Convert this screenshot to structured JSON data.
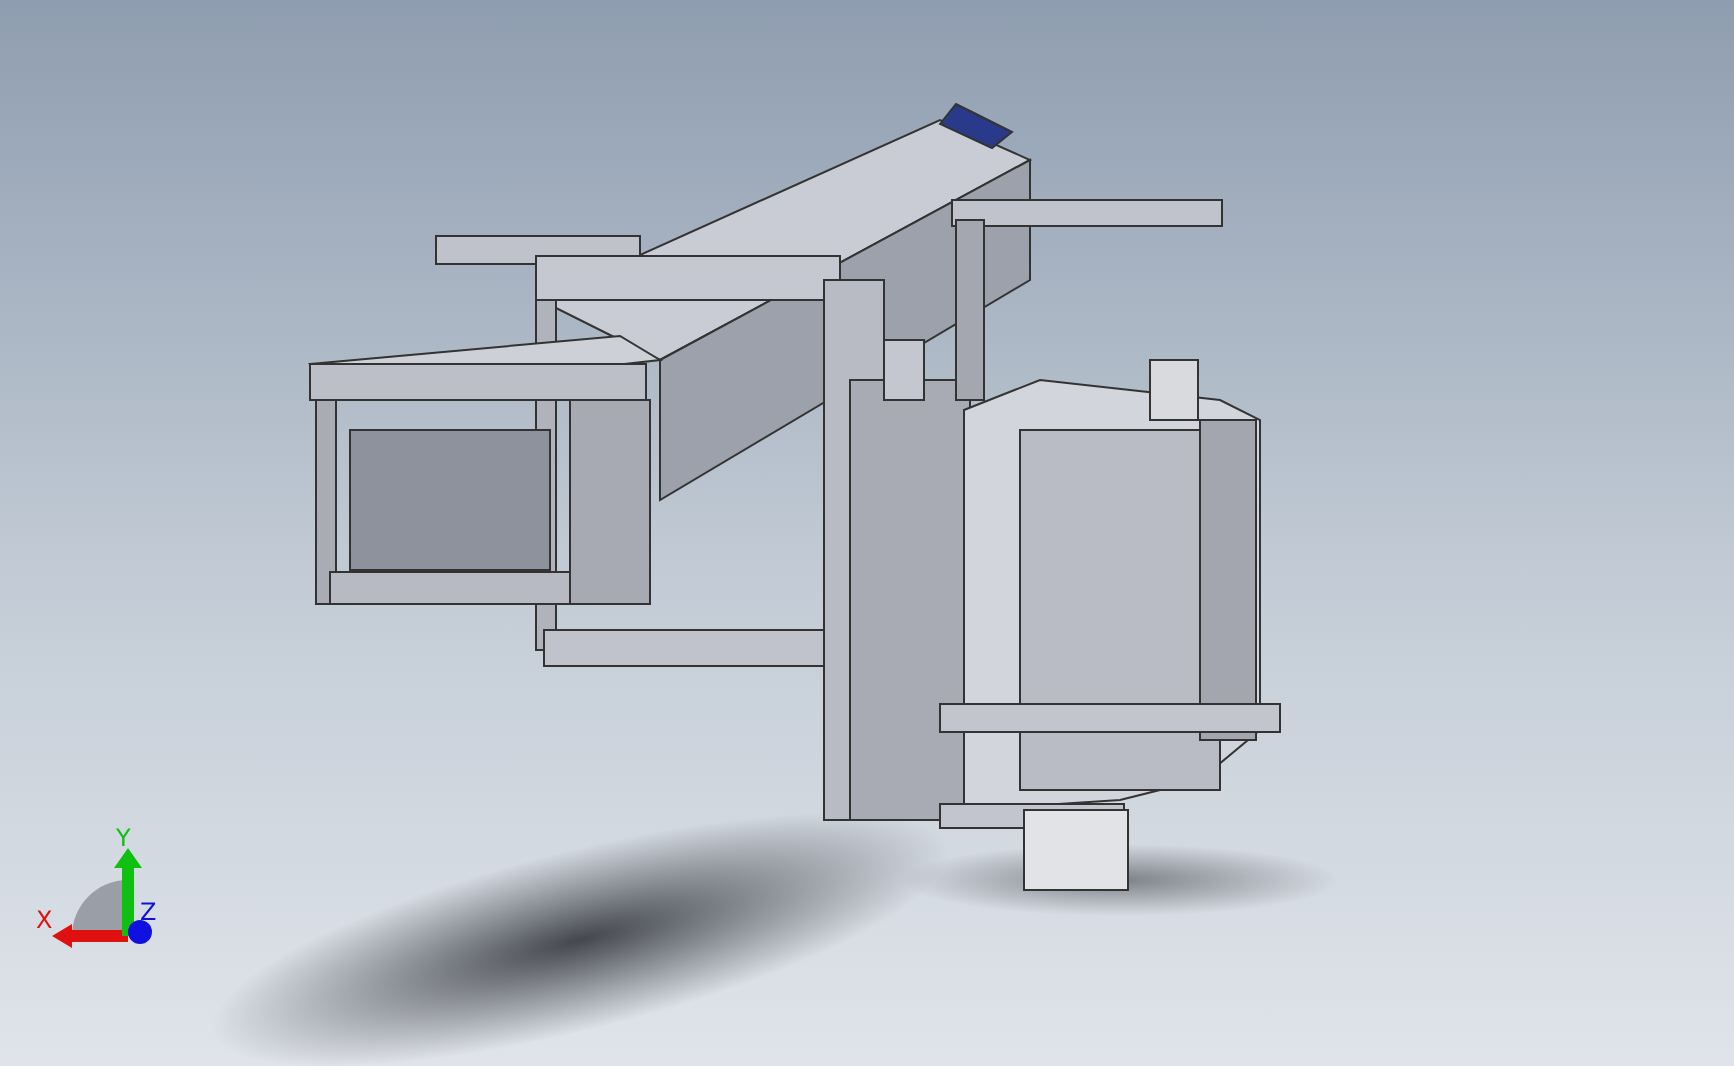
{
  "viewport": {
    "triad": {
      "axes": [
        {
          "kind": "x",
          "label": "X",
          "color": "#e01010"
        },
        {
          "kind": "y",
          "label": "Y",
          "color": "#10c010"
        },
        {
          "kind": "z",
          "label": "Z",
          "color": "#1010e0"
        }
      ]
    }
  }
}
